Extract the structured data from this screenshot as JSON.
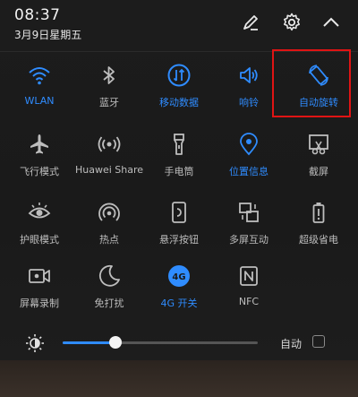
{
  "status": {
    "time": "08:37",
    "date": "3月9日星期五"
  },
  "header_icons": [
    "edit-icon",
    "gear-icon",
    "chevron-up-icon"
  ],
  "tiles": [
    {
      "label": "WLAN",
      "icon": "wifi-icon",
      "on": true
    },
    {
      "label": "蓝牙",
      "icon": "bluetooth-icon",
      "on": false
    },
    {
      "label": "移动数据",
      "icon": "mobile-data-icon",
      "on": true
    },
    {
      "label": "响铃",
      "icon": "speaker-icon",
      "on": true
    },
    {
      "label": "自动旋转",
      "icon": "auto-rotate-icon",
      "on": true
    },
    {
      "label": "飞行模式",
      "icon": "airplane-icon",
      "on": false
    },
    {
      "label": "Huawei Share",
      "icon": "huawei-share-icon",
      "on": false
    },
    {
      "label": "手电筒",
      "icon": "flashlight-icon",
      "on": false
    },
    {
      "label": "位置信息",
      "icon": "location-icon",
      "on": true
    },
    {
      "label": "截屏",
      "icon": "screenshot-icon",
      "on": false
    },
    {
      "label": "护眼模式",
      "icon": "eye-icon",
      "on": false
    },
    {
      "label": "热点",
      "icon": "hotspot-icon",
      "on": false
    },
    {
      "label": "悬浮按钮",
      "icon": "floating-button-icon",
      "on": false
    },
    {
      "label": "多屏互动",
      "icon": "multiscreen-icon",
      "on": false
    },
    {
      "label": "超级省电",
      "icon": "battery-saver-icon",
      "on": false
    },
    {
      "label": "屏幕录制",
      "icon": "screen-record-icon",
      "on": false
    },
    {
      "label": "免打扰",
      "icon": "moon-icon",
      "on": false
    },
    {
      "label": "4G 开关",
      "icon": "4g-icon",
      "on": true,
      "badge": "4G"
    },
    {
      "label": "NFC",
      "icon": "nfc-icon",
      "on": false
    }
  ],
  "brightness": {
    "icon": "brightness-icon",
    "level": 0.27,
    "auto_label": "自动",
    "auto_checked": false
  },
  "colors": {
    "accent": "#2f8cff",
    "inactive": "#bdbdbd",
    "highlight": "#e01414"
  }
}
